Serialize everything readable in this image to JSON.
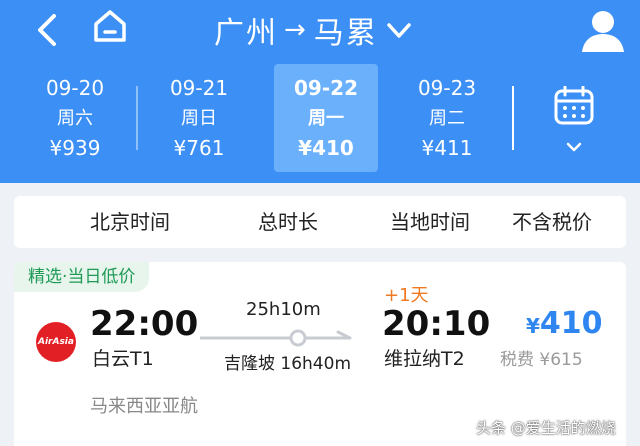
{
  "header": {
    "origin": "广州",
    "route_arrow": "→",
    "destination": "马累"
  },
  "dates": [
    {
      "date": "09-20",
      "weekday": "周六",
      "price": "¥939",
      "selected": false
    },
    {
      "date": "09-21",
      "weekday": "周日",
      "price": "¥761",
      "selected": false
    },
    {
      "date": "09-22",
      "weekday": "周一",
      "price": "¥410",
      "selected": true
    },
    {
      "date": "09-23",
      "weekday": "周二",
      "price": "¥411",
      "selected": false
    }
  ],
  "columns": {
    "beijing_time": "北京时间",
    "total_duration": "总时长",
    "local_time": "当地时间",
    "tax_excluded": "不含税价"
  },
  "flight": {
    "badge": "精选·当日低价",
    "airline_logo_text": "AirAsia",
    "departure_time": "22:00",
    "departure_airport": "白云T1",
    "duration": "25h10m",
    "stopover": "吉隆坡 16h40m",
    "next_day": "+1天",
    "arrival_time": "20:10",
    "arrival_airport": "维拉纳T2",
    "currency": "¥",
    "price": "410",
    "tax": "税费 ¥615",
    "airline_name": "马来西亚亚航"
  },
  "watermark": "头条 @爱生活的燃烧",
  "colors": {
    "header_blue": "#3c8ff5",
    "selected_tab": "#6ab0fb",
    "price_blue": "#2f86f0",
    "badge_green": "#1f9a57",
    "next_day_orange": "#f07a22",
    "airline_red": "#e31f26"
  },
  "icons": {
    "back": "back-arrow-icon",
    "home": "home-icon",
    "route_dropdown": "chevron-down-icon",
    "user": "user-icon",
    "calendar": "calendar-icon",
    "calendar_expand": "chevron-down-icon"
  }
}
